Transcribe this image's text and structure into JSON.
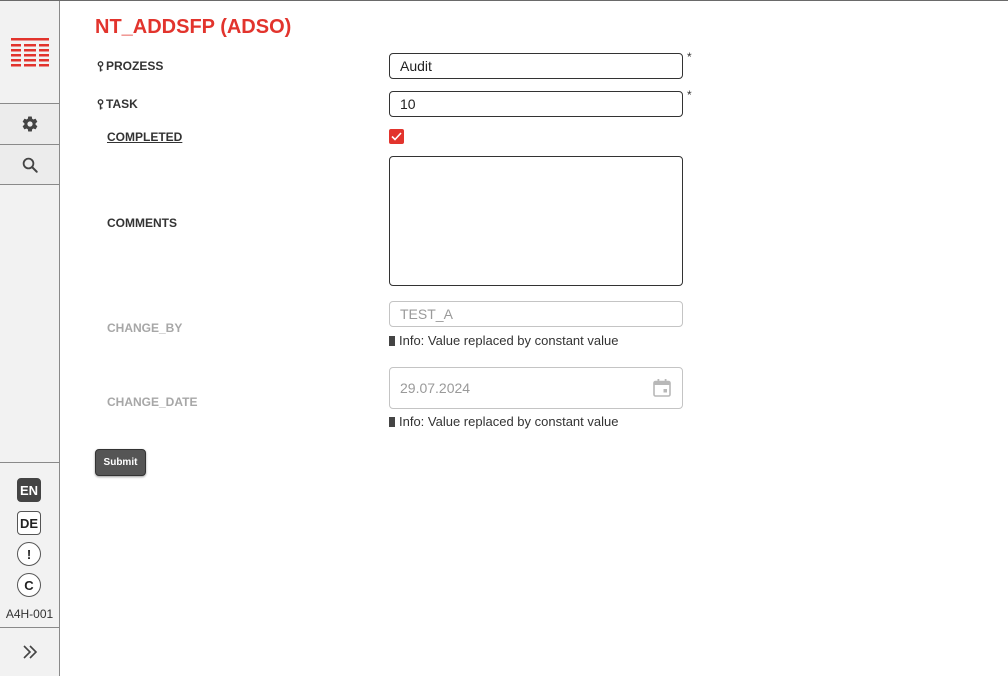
{
  "app": {
    "system_id": "A4H-001",
    "languages": [
      {
        "code": "EN",
        "active": true
      },
      {
        "code": "DE",
        "active": false
      }
    ],
    "alert_symbol": "!",
    "c_symbol": "C",
    "accent_color": "#e2342d"
  },
  "sidebar": {
    "logo_icon": "table-logo-icon",
    "buttons": [
      {
        "name": "settings",
        "icon": "gear-icon"
      },
      {
        "name": "search",
        "icon": "search-icon"
      }
    ],
    "expand_icon": "double-chevron-right-icon"
  },
  "form": {
    "title": "NT_ADDSFP (ADSO)",
    "fields": {
      "prozess": {
        "label": "PROZESS",
        "value": "Audit",
        "required_mark": "*",
        "key": true
      },
      "task": {
        "label": "TASK",
        "value": "10",
        "required_mark": "*",
        "key": true
      },
      "completed": {
        "label": "COMPLETED",
        "checked": true
      },
      "comments": {
        "label": "COMMENTS",
        "value": ""
      },
      "change_by": {
        "label": "CHANGE_BY",
        "value": "TEST_A",
        "info": "Info: Value replaced by constant value"
      },
      "change_date": {
        "label": "CHANGE_DATE",
        "value": "29.07.2024",
        "info": "Info: Value replaced by constant value"
      }
    },
    "submit_label": "Submit"
  }
}
